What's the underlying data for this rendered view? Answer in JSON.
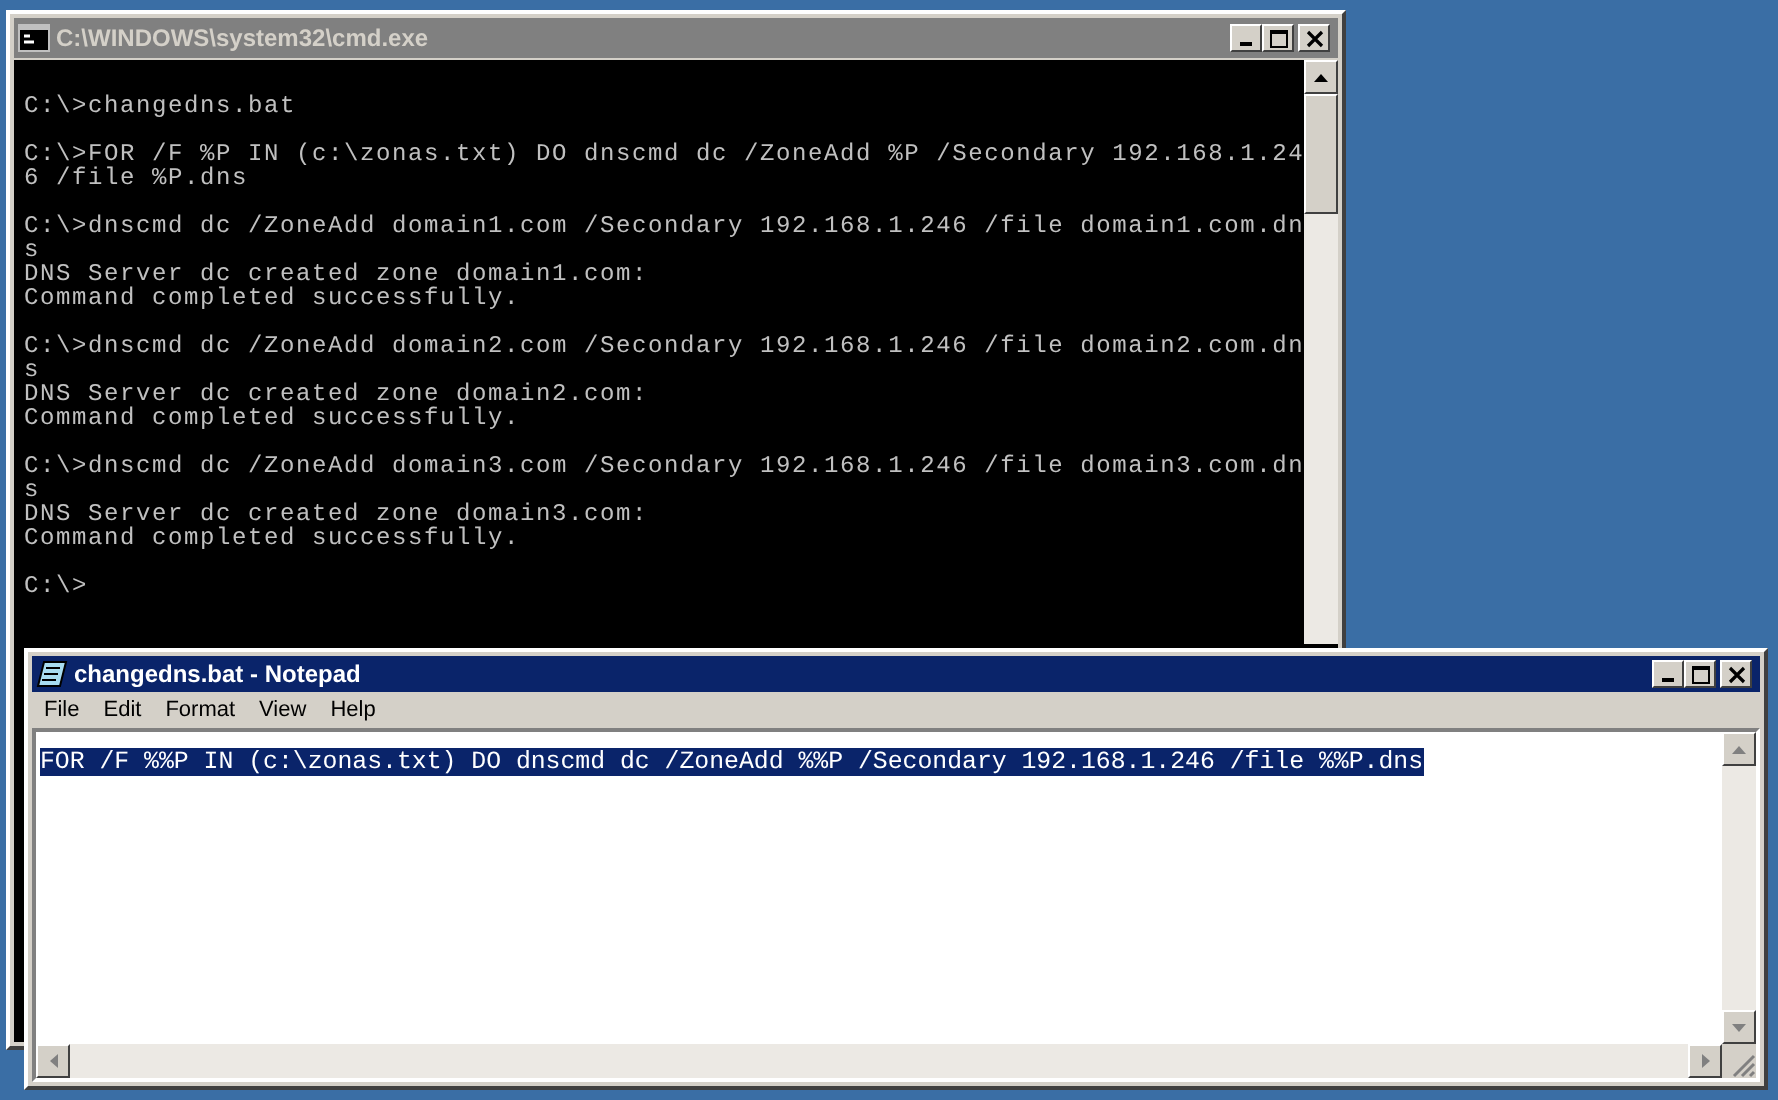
{
  "cmd_window": {
    "title": "C:\\WINDOWS\\system32\\cmd.exe",
    "active": false,
    "console_blocks": [
      [
        "C:\\>changedns.bat"
      ],
      [
        "C:\\>FOR /F %P IN (c:\\zonas.txt) DO dnscmd dc /ZoneAdd %P /Secondary 192.168.1.24",
        "6 /file %P.dns"
      ],
      [
        "C:\\>dnscmd dc /ZoneAdd domain1.com /Secondary 192.168.1.246 /file domain1.com.dn",
        "s",
        "DNS Server dc created zone domain1.com:",
        "Command completed successfully."
      ],
      [
        "C:\\>dnscmd dc /ZoneAdd domain2.com /Secondary 192.168.1.246 /file domain2.com.dn",
        "s",
        "DNS Server dc created zone domain2.com:",
        "Command completed successfully."
      ],
      [
        "C:\\>dnscmd dc /ZoneAdd domain3.com /Secondary 192.168.1.246 /file domain3.com.dn",
        "s",
        "DNS Server dc created zone domain3.com:",
        "Command completed successfully."
      ],
      [
        "C:\\>"
      ]
    ]
  },
  "notepad_window": {
    "title": "changedns.bat - Notepad",
    "active": true,
    "menu": [
      "File",
      "Edit",
      "Format",
      "View",
      "Help"
    ],
    "text": "FOR /F %%P IN (c:\\zonas.txt) DO dnscmd dc /ZoneAdd %%P /Secondary 192.168.1.246 /file %%P.dns",
    "text_selected": true
  }
}
